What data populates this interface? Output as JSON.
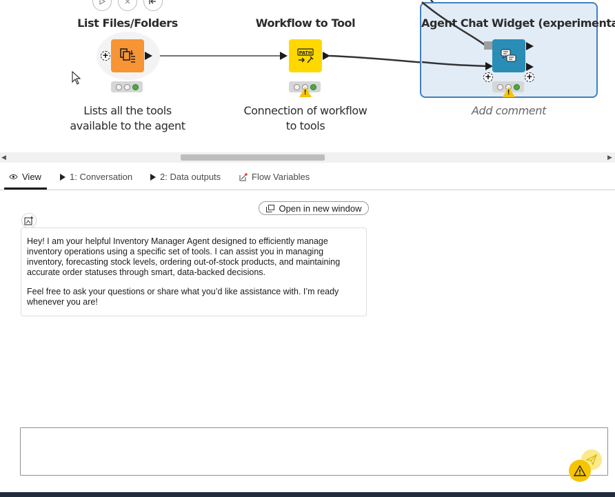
{
  "canvas": {
    "nodes": [
      {
        "title": "List Files/Folders",
        "comment": [
          "Lists all the tools",
          "available to the agent"
        ]
      },
      {
        "title": "Workflow to Tool",
        "comment": [
          "Connection of workflow",
          "to tools"
        ],
        "icon_text": "PATH"
      },
      {
        "title": "Agent Chat Widget (experimental)",
        "comment": [
          "Add comment"
        ]
      }
    ]
  },
  "tabs": [
    {
      "label": "View",
      "icon": "eye-icon"
    },
    {
      "label": "1: Conversation",
      "icon": "play-icon"
    },
    {
      "label": "2: Data outputs",
      "icon": "play-icon"
    },
    {
      "label": "Flow Variables",
      "icon": "flow-variable-icon"
    }
  ],
  "view": {
    "open_window_label": "Open in new window",
    "message_paragraphs": [
      "Hey! I am your helpful Inventory Manager Agent designed to efficiently manage inventory operations using a specific set of tools. I can assist you in managing inventory, forecasting stock levels, ordering out-of-stock products, and maintaining accurate order statuses through smart, data-backed decisions.",
      "Feel free to ask your questions or share what you’d like assistance with. I’m ready whenever you are!"
    ],
    "input_value": ""
  },
  "colors": {
    "list_files_node": "#f79433",
    "workflow_to_tool_node": "#ffd800",
    "agent_chat_node": "#2a8db5",
    "selection_border": "#3f7fbf",
    "selection_fill": "#e2ecf6",
    "warning": "#f6c400"
  }
}
